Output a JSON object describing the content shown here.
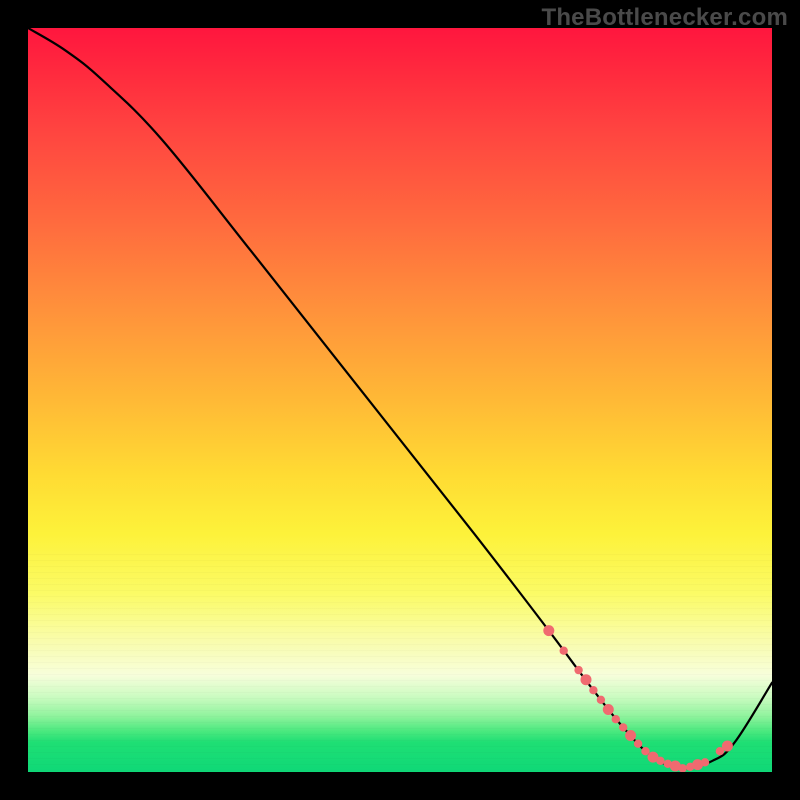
{
  "watermark": "TheBottlenecker.com",
  "chart_data": {
    "type": "line",
    "title": "",
    "xlabel": "",
    "ylabel": "",
    "xlim": [
      0,
      100
    ],
    "ylim": [
      0,
      100
    ],
    "grid": false,
    "series": [
      {
        "name": "curve",
        "x": [
          0,
          5,
          10,
          18,
          30,
          45,
          60,
          70,
          76,
          80,
          84,
          88,
          92,
          95,
          100
        ],
        "y": [
          100,
          97,
          93,
          85,
          70,
          51,
          32,
          19,
          11,
          6,
          2,
          0.5,
          1.5,
          4,
          12
        ]
      }
    ],
    "markers": {
      "name": "highlight-points",
      "color": "#f06a70",
      "x": [
        70,
        72,
        74,
        75,
        76,
        77,
        78,
        79,
        80,
        81,
        82,
        83,
        84,
        85,
        86,
        87,
        88,
        89,
        90,
        91,
        93,
        94
      ],
      "y": [
        19,
        16.3,
        13.7,
        12.4,
        11.0,
        9.7,
        8.4,
        7.1,
        6.0,
        4.9,
        3.8,
        2.8,
        2.0,
        1.5,
        1.1,
        0.8,
        0.5,
        0.7,
        1.0,
        1.3,
        2.8,
        3.5
      ]
    },
    "background_gradient": {
      "top": "#ff163e",
      "mid": "#ffdb33",
      "bottom": "#0fd877"
    }
  }
}
